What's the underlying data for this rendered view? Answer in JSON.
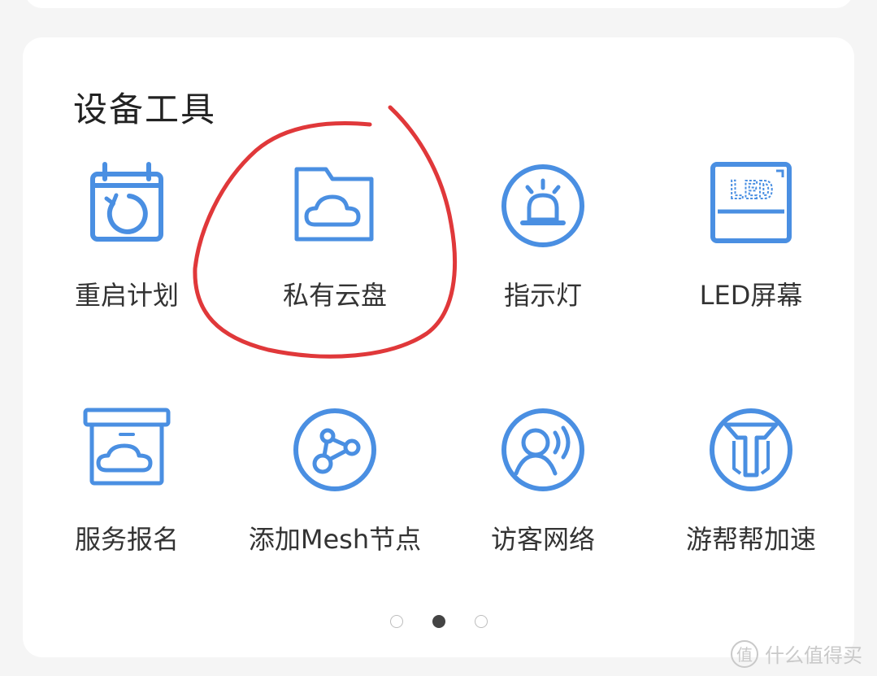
{
  "section": {
    "title": "设备工具"
  },
  "tools": [
    {
      "label": "重启计划",
      "icon": "calendar-restart-icon"
    },
    {
      "label": "私有云盘",
      "icon": "cloud-folder-icon"
    },
    {
      "label": "指示灯",
      "icon": "indicator-light-icon"
    },
    {
      "label": "LED屏幕",
      "icon": "led-screen-icon"
    },
    {
      "label": "服务报名",
      "icon": "cloud-box-icon"
    },
    {
      "label": "添加Mesh节点",
      "icon": "mesh-node-icon"
    },
    {
      "label": "访客网络",
      "icon": "guest-network-icon"
    },
    {
      "label": "游帮帮加速",
      "icon": "game-accelerator-icon"
    }
  ],
  "pager": {
    "total": 3,
    "active": 1
  },
  "watermark": {
    "text": "什么值得买",
    "logo": "值"
  },
  "colors": {
    "icon_blue": "#4a8fe2",
    "annotation_red": "#e0383a"
  }
}
